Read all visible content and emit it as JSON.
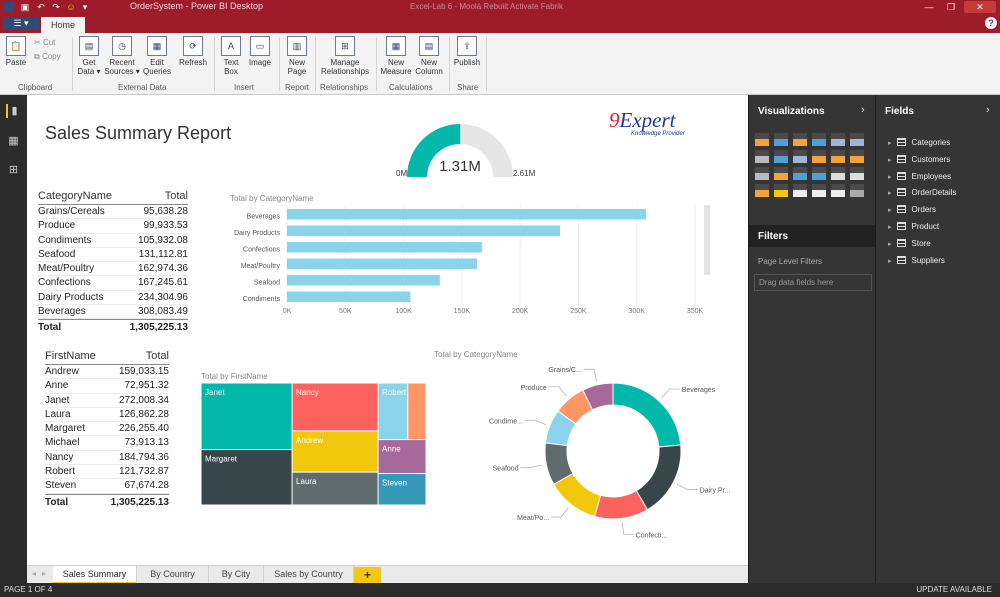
{
  "window": {
    "title": "OrderSystem - Power BI Desktop",
    "faded_caption": "Excel-Lab 6 - Moolá Rebuilt Activate Fabrik",
    "controls": [
      "—",
      "❐",
      "✕"
    ]
  },
  "quick_access": [
    "save-icon",
    "undo-icon",
    "redo-icon",
    "smile-icon",
    "dropdown-icon"
  ],
  "tabs": {
    "file": "▾",
    "home": "Home",
    "help": "?"
  },
  "ribbon": {
    "paste": "Paste",
    "cut": "Cut",
    "copy": "Copy",
    "get_data": "Get\nData ▾",
    "recent_sources": "Recent\nSources ▾",
    "edit_queries": "Edit\nQueries",
    "refresh": "Refresh",
    "text_box": "Text\nBox",
    "image": "Image",
    "new_page": "New\nPage",
    "manage_relationships": "Manage\nRelationships",
    "new_measure": "New\nMeasure",
    "new_column": "New\nColumn",
    "publish": "Publish",
    "groups": {
      "clipboard": "Clipboard",
      "external_data": "External Data",
      "insert": "Insert",
      "report": "Report",
      "relationships": "Relationships",
      "calculations": "Calculations",
      "share": "Share"
    }
  },
  "report": {
    "title": "Sales Summary Report",
    "logo": {
      "main": "9Expert",
      "tagline": "Knowledge Provider"
    },
    "gauge": {
      "value_label": "1.31M",
      "min_label": "0M",
      "max_label": "2.61M",
      "value": 1.31,
      "min": 0,
      "max": 2.61,
      "color": "#01B8AA"
    }
  },
  "category_table": {
    "headers": [
      "CategoryName",
      "Total"
    ],
    "rows": [
      [
        "Grains/Cereals",
        "95,638.28"
      ],
      [
        "Produce",
        "99,933.53"
      ],
      [
        "Condiments",
        "105,932.08"
      ],
      [
        "Seafood",
        "131,112.81"
      ],
      [
        "Meat/Poultry",
        "162,974.36"
      ],
      [
        "Confections",
        "167,245.61"
      ],
      [
        "Dairy Products",
        "234,304.96"
      ],
      [
        "Beverages",
        "308,083.49"
      ]
    ],
    "total": [
      "Total",
      "1,305,225.13"
    ]
  },
  "firstname_table": {
    "headers": [
      "FirstName",
      "Total"
    ],
    "rows": [
      [
        "Andrew",
        "159,033.15"
      ],
      [
        "Anne",
        "72,951.32"
      ],
      [
        "Janet",
        "272,008.34"
      ],
      [
        "Laura",
        "126,862.28"
      ],
      [
        "Margaret",
        "226,255.40"
      ],
      [
        "Michael",
        "73,913.13"
      ],
      [
        "Nancy",
        "184,794.36"
      ],
      [
        "Robert",
        "121,732.87"
      ],
      [
        "Steven",
        "67,674.28"
      ]
    ],
    "total": [
      "Total",
      "1,305,225.13"
    ]
  },
  "bar_chart_label": "Total by CategoryName",
  "treemap_label": "Total by FirstName",
  "donut_label": "Total by CategoryName",
  "chart_data": [
    {
      "type": "bar",
      "title": "Total by CategoryName",
      "categories": [
        "Beverages",
        "Dairy Products",
        "Confections",
        "Meat/Poultry",
        "Seafood",
        "Condiments"
      ],
      "values": [
        308083.49,
        234304.96,
        167245.61,
        162974.36,
        131112.81,
        105932.08
      ],
      "xlim": [
        0,
        350000
      ],
      "ticks": [
        "0K",
        "50K",
        "100K",
        "150K",
        "200K",
        "250K",
        "300K",
        "350K"
      ],
      "color": "#8AD4EB",
      "grid": true
    },
    {
      "type": "treemap",
      "title": "Total by FirstName",
      "labels": [
        "Janet",
        "Margaret",
        "Nancy",
        "Andrew",
        "Laura",
        "Robert",
        "Anne",
        "Steven"
      ],
      "values": [
        272008.34,
        226255.4,
        184794.36,
        159033.15,
        126862.28,
        121732.87,
        72951.32,
        67674.28
      ],
      "colors": [
        "#01B8AA",
        "#374649",
        "#FD625E",
        "#F2C80F",
        "#5F6B6D",
        "#8AD4EB",
        "#A66999",
        "#3599B8",
        "#FE9666"
      ]
    },
    {
      "type": "pie",
      "title": "Total by CategoryName",
      "donut": true,
      "labels": [
        "Beverages",
        "Dairy Pr...",
        "Confecti...",
        "Meat/Po...",
        "Seafood",
        "Condime...",
        "Produce",
        "Grains/C..."
      ],
      "values": [
        308083.49,
        234304.96,
        167245.61,
        162974.36,
        131112.81,
        105932.08,
        99933.53,
        95638.28
      ],
      "colors": [
        "#01B8AA",
        "#374649",
        "#FD625E",
        "#F2C80F",
        "#5F6B6D",
        "#8AD4EB",
        "#FE9666",
        "#A66999"
      ]
    }
  ],
  "page_tabs": [
    "Sales Summary",
    "By Country",
    "By City",
    "Sales by Country"
  ],
  "add_page": "+",
  "status": {
    "page": "PAGE 1 OF 4",
    "update": "UPDATE AVAILABLE"
  },
  "visualizations": {
    "title": "Visualizations",
    "chevron": "›"
  },
  "filters": {
    "title": "Filters",
    "page_level": "Page Level Filters",
    "drag_hint": "Drag data fields here"
  },
  "fields": {
    "title": "Fields",
    "chevron": "›",
    "tables": [
      "Categories",
      "Customers",
      "Employees",
      "OrderDetails",
      "Orders",
      "Product",
      "Store",
      "Suppliers"
    ]
  }
}
